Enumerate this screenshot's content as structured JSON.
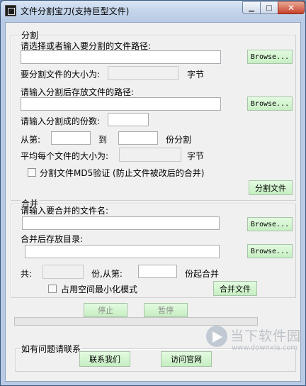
{
  "window": {
    "title": "文件分割宝刀(支持巨型文件)"
  },
  "split": {
    "group_label": "分割",
    "source_prompt": "请选择或者输入要分割的文件路径:",
    "source_value": "",
    "browse_label": "Browse...",
    "size_prompt": "要分割文件的大小为:",
    "size_unit": "字节",
    "dest_prompt": "请输入分割后存放文件的路径:",
    "dest_value": "",
    "parts_prompt": "请输入分割成的份数:",
    "from_label": "从第:",
    "to_label": "到",
    "range_suffix": "份分割",
    "avg_prompt": "平均每个文件的大小为:",
    "avg_unit": "字节",
    "md5_label": "分割文件MD5验证 (防止文件被改后的合并)",
    "md5_checked": false,
    "split_button": "分割文件"
  },
  "merge": {
    "group_label": "合并",
    "name_prompt": "请输入要合并的文件名:",
    "dir_prompt": "合并后存放目录:",
    "browse_label": "Browse...",
    "total_label": "共:",
    "from_label": "份,从第:",
    "from_suffix": "份起合并",
    "minimize_label": "占用空间最小化模式",
    "minimize_checked": false,
    "merge_button": "合并文件"
  },
  "controls": {
    "stop_label": "停止",
    "pause_label": "暂停",
    "progress_fraction": 0
  },
  "contact": {
    "group_label": "如有问题请联系",
    "contact_button": "联系我们",
    "website_button": "访问官网"
  },
  "watermark": {
    "text": "当下软件园",
    "url": "www.downxia.com"
  }
}
